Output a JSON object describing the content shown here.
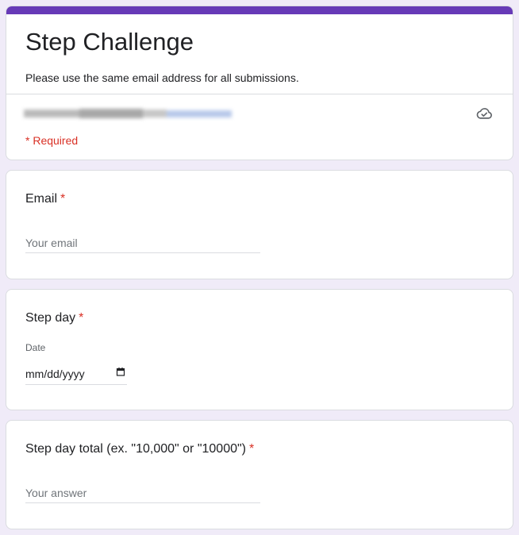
{
  "form": {
    "title": "Step Challenge",
    "description": "Please use the same email address for all submissions.",
    "required_note": "* Required",
    "accent_color": "#673ab7",
    "background_color": "#f0ebf8",
    "required_color": "#d93025",
    "account_icon": "cloud-check-icon"
  },
  "questions": {
    "email": {
      "label": "Email",
      "required_marker": "*",
      "placeholder": "Your email",
      "value": ""
    },
    "step_day": {
      "label": "Step day",
      "required_marker": "*",
      "sub_label": "Date",
      "placeholder": "mm/dd/yyyy",
      "icon": "calendar-icon"
    },
    "step_total": {
      "label": "Step day total (ex. \"10,000\" or \"10000\")",
      "required_marker": "*",
      "placeholder": "Your answer",
      "value": ""
    }
  }
}
